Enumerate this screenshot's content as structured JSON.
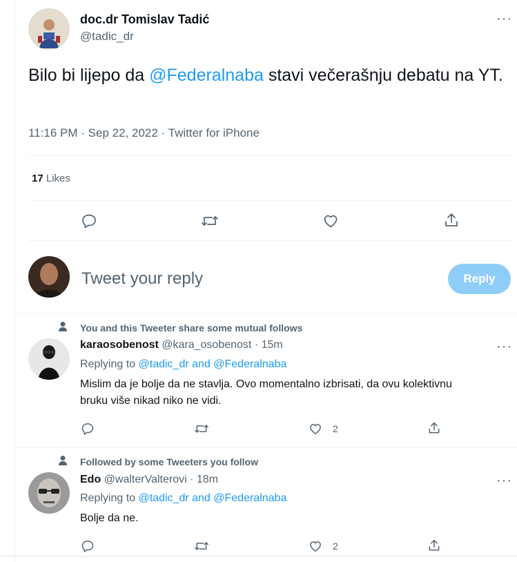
{
  "tweet": {
    "author_name": "doc.dr Tomislav Tadić",
    "author_handle": "@tadic_dr",
    "text_before": "Bilo bi lijepo da ",
    "mention": "@Federalnaba",
    "text_after": "  stavi večerašnju debatu na YT.",
    "time": "11:16 PM",
    "date": "Sep 22, 2022",
    "source": "Twitter for iPhone",
    "likes_count": "17",
    "likes_label": "Likes",
    "more_label": "···"
  },
  "compose": {
    "placeholder": "Tweet your reply",
    "button_label": "Reply"
  },
  "replies": [
    {
      "context": "You and this Tweeter share some mutual follows",
      "name": "karaosobenost",
      "handle": "@kara_osobenost",
      "time": "15m",
      "replying_prefix": "Replying to ",
      "replying_to": "@tadic_dr and @Federalnaba",
      "text": "Mislim da je bolje da ne stavlja. Ovo momentalno izbrisati, da ovu kolektivnu bruku više nikad niko ne vidi.",
      "like_count": "2"
    },
    {
      "context": "Followed by some Tweeters you follow",
      "name": "Edo",
      "handle": "@walterValterovi",
      "time": "18m",
      "replying_prefix": "Replying to ",
      "replying_to": "@tadic_dr and @Federalnaba",
      "text": "Bolje da ne.",
      "like_count": "2"
    }
  ],
  "separator": "·",
  "colors": {
    "accent": "#1d9bf0",
    "reply_button_disabled": "#8ecdf8",
    "secondary_text": "#536471",
    "divider": "#eff3f4"
  },
  "icons": [
    "reply-icon",
    "retweet-icon",
    "like-icon",
    "share-icon",
    "person-icon",
    "more-icon"
  ]
}
